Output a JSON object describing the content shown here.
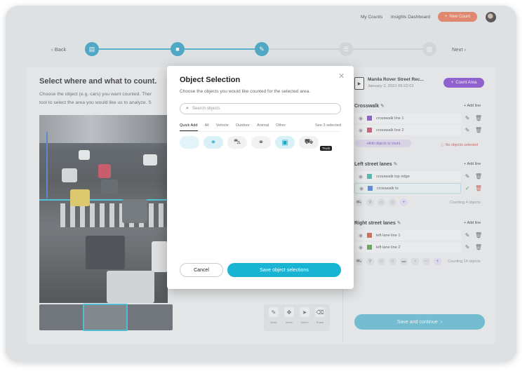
{
  "header": {
    "my_counts": "My Counts",
    "insights": "Insights Dashboard",
    "new_count": "New Count"
  },
  "stepper": {
    "back": "Back",
    "next": "Next"
  },
  "left": {
    "title": "Select where and what to count.",
    "desc_line1": "Choose the object (e.g. cars) you want counted. Ther",
    "desc_line2": "tool to select the area you would like us to analyze. S"
  },
  "tools": [
    {
      "icon": "draw-icon",
      "label": "Draw"
    },
    {
      "icon": "move-icon",
      "label": "Move"
    },
    {
      "icon": "select-icon",
      "label": "Select"
    },
    {
      "icon": "erase-icon",
      "label": "Erase"
    }
  ],
  "video": {
    "title": "Manila Rover Street Rec...",
    "date": "January 3, 2021  05:22:01",
    "count_area": "Count Area"
  },
  "areas": [
    {
      "title": "Crosswalk",
      "add_line": "Add line",
      "lines": [
        {
          "label": "crosswalk line 1",
          "color": "#7d3fc9"
        },
        {
          "label": "crosswalk line 2",
          "color": "#c9405e"
        }
      ],
      "add_objects": "Add objects to count",
      "no_objects": "No objects selected"
    },
    {
      "title": "Left street lanes",
      "add_line": "Add line",
      "lines": [
        {
          "label": "crosswalk top edge",
          "color": "#2fb5a2"
        },
        {
          "label": "crosswalk to",
          "color": "#3f79c9"
        }
      ],
      "counting": "Counting 4 objects"
    },
    {
      "title": "Right street lanes",
      "add_line": "Add line",
      "lines": [
        {
          "label": "left lane line 1",
          "color": "#d0552f"
        },
        {
          "label": "left lane line 2",
          "color": "#4c9b3a"
        }
      ],
      "counting": "Counting 14 objects"
    }
  ],
  "save_continue": "Save and continue",
  "modal": {
    "title": "Object Selection",
    "subtitle": "Choose the objects you would like counted for the selected area.",
    "search_placeholder": "Search objects",
    "tabs": [
      "Quick Add",
      "All",
      "Vehicle",
      "Outdoor",
      "Animal",
      "Other"
    ],
    "selected_count": "See 3 selected",
    "tooltip": "Truck",
    "cancel": "Cancel",
    "save": "Save object selections"
  },
  "colors": {
    "accent": "#19b3d3",
    "purple": "#7f3fcf",
    "orange": "#e8704f"
  }
}
